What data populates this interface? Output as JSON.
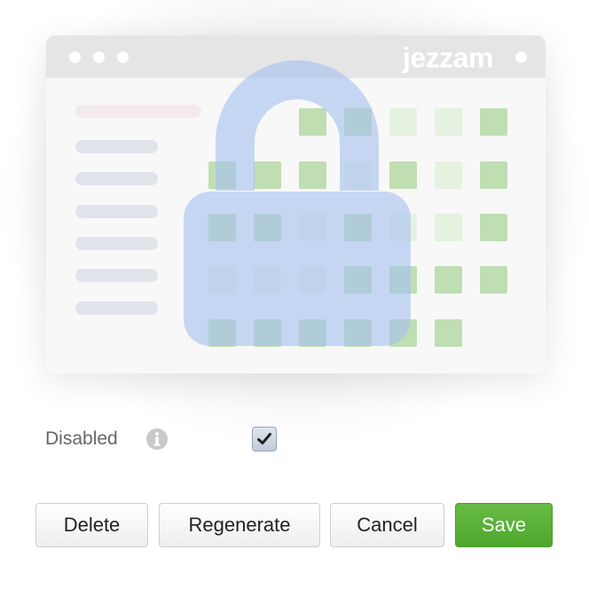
{
  "preview": {
    "brand": "jezzam",
    "colors": {
      "lock": "#a7c2f0",
      "grid_cell": "#bfdeb2",
      "grid_cell_light": "#e6f2e0",
      "bar": "#e5e5e5"
    },
    "icons": [
      "lock-icon"
    ]
  },
  "form": {
    "disabled_label": "Disabled",
    "disabled_checked": true,
    "info_icon": "info-icon",
    "check_icon": "checkmark-icon"
  },
  "actions": {
    "delete_label": "Delete",
    "regenerate_label": "Regenerate",
    "cancel_label": "Cancel",
    "save_label": "Save",
    "save_color": "#5cb33a"
  }
}
